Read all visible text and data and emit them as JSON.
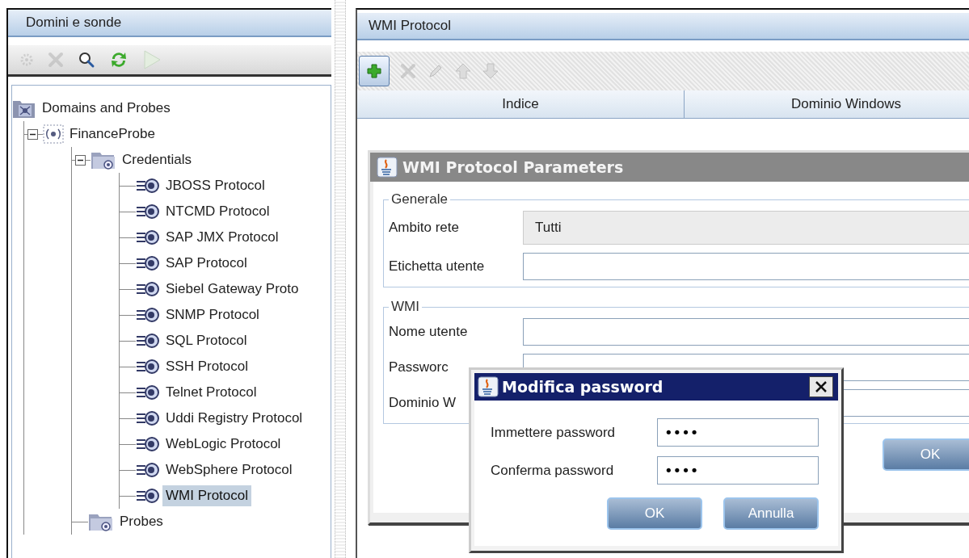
{
  "left_panel": {
    "title": "Domini e sonde",
    "toolbar": [
      {
        "kind": "gear",
        "disabled": true
      },
      {
        "kind": "delete",
        "disabled": true
      },
      {
        "kind": "search",
        "disabled": false
      },
      {
        "kind": "refresh",
        "disabled": false
      },
      {
        "kind": "play",
        "disabled": true
      }
    ],
    "tree": [
      {
        "label": "Domains and Probes",
        "kind": "domain",
        "selected": false,
        "children": [
          {
            "label": "FinanceProbe",
            "kind": "probe",
            "selected": false,
            "expanded": true,
            "children": [
              {
                "label": "Credentials",
                "kind": "folder",
                "selected": false,
                "expanded": true,
                "children": [
                  {
                    "label": "JBOSS Protocol",
                    "kind": "protocol",
                    "selected": false
                  },
                  {
                    "label": "NTCMD Protocol",
                    "kind": "protocol",
                    "selected": false
                  },
                  {
                    "label": "SAP JMX Protocol",
                    "kind": "protocol",
                    "selected": false
                  },
                  {
                    "label": "SAP Protocol",
                    "kind": "protocol",
                    "selected": false
                  },
                  {
                    "label": "Siebel Gateway Proto",
                    "kind": "protocol",
                    "selected": false
                  },
                  {
                    "label": "SNMP Protocol",
                    "kind": "protocol",
                    "selected": false
                  },
                  {
                    "label": "SQL Protocol",
                    "kind": "protocol",
                    "selected": false
                  },
                  {
                    "label": "SSH Protocol",
                    "kind": "protocol",
                    "selected": false
                  },
                  {
                    "label": "Telnet Protocol",
                    "kind": "protocol",
                    "selected": false
                  },
                  {
                    "label": "Uddi Registry Protocol",
                    "kind": "protocol",
                    "selected": false
                  },
                  {
                    "label": "WebLogic Protocol",
                    "kind": "protocol",
                    "selected": false
                  },
                  {
                    "label": "WebSphere Protocol",
                    "kind": "protocol",
                    "selected": false
                  },
                  {
                    "label": "WMI Protocol",
                    "kind": "protocol",
                    "selected": true
                  }
                ]
              },
              {
                "label": "Probes",
                "kind": "folder",
                "selected": false
              }
            ]
          }
        ]
      }
    ]
  },
  "right_panel": {
    "title": "WMI Protocol",
    "toolbar": [
      {
        "kind": "add",
        "disabled": false
      },
      {
        "kind": "delete",
        "disabled": true
      },
      {
        "kind": "edit",
        "disabled": true
      },
      {
        "kind": "up",
        "disabled": true
      },
      {
        "kind": "down",
        "disabled": true
      }
    ],
    "table": {
      "columns": [
        "Indice",
        "Dominio Windows"
      ]
    }
  },
  "parameters_dialog": {
    "title": "WMI Protocol Parameters",
    "groups": [
      {
        "legend": "Generale",
        "fields": [
          {
            "label": "Ambito rete",
            "kind": "readonly",
            "value": "Tutti"
          },
          {
            "label": "Etichetta utente",
            "kind": "text"
          }
        ]
      },
      {
        "legend": "WMI",
        "fields": [
          {
            "label": "Nome utente",
            "kind": "text"
          },
          {
            "label": "Passworc",
            "kind": "text"
          },
          {
            "label": "Dominio W",
            "kind": "text"
          }
        ]
      }
    ],
    "buttons": [
      "OK"
    ]
  },
  "password_dialog": {
    "title": "Modifica password",
    "fields": [
      {
        "label": "Immettere password",
        "value": "••••"
      },
      {
        "label": "Conferma password",
        "value": "••••"
      }
    ],
    "buttons": [
      "OK",
      "Annulla"
    ]
  }
}
